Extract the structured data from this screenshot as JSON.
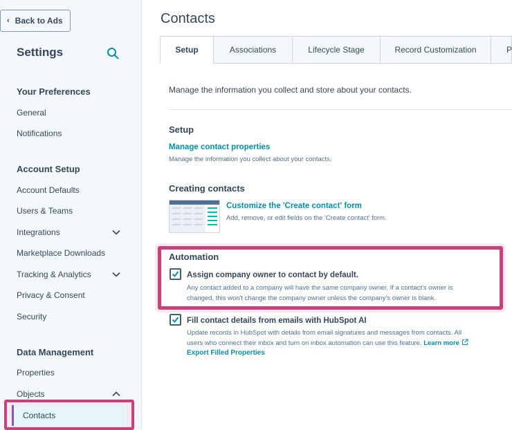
{
  "sidebar": {
    "back_label": "Back to Ads",
    "title": "Settings",
    "sections": [
      {
        "title": "Your Preferences",
        "items": [
          "General",
          "Notifications"
        ]
      },
      {
        "title": "Account Setup",
        "items": [
          "Account Defaults",
          "Users & Teams",
          "Integrations",
          "Marketplace Downloads",
          "Tracking & Analytics",
          "Privacy & Consent",
          "Security"
        ]
      },
      {
        "title": "Data Management",
        "items": [
          "Properties",
          "Objects"
        ]
      }
    ],
    "active_item": "Contacts"
  },
  "main": {
    "title": "Contacts",
    "tabs": [
      "Setup",
      "Associations",
      "Lifecycle Stage",
      "Record Customization",
      "P"
    ],
    "intro": "Manage the information you collect and store about your contacts.",
    "setup": {
      "heading": "Setup",
      "link": "Manage contact properties",
      "desc": "Manage the information you collect about your contacts."
    },
    "creating": {
      "heading": "Creating contacts",
      "link": "Customize the 'Create contact' form",
      "desc": "Add, remove, or edit fields on the 'Create contact' form."
    },
    "automation": {
      "heading": "Automation",
      "option1": {
        "label": "Assign company owner to contact by default.",
        "desc_line1": "Any contact added to a company will have the same company owner. If a contact's owner is",
        "desc_line2": "changed, this won't change the company owner unless the company's owner is blank."
      },
      "option2": {
        "label": "Fill contact details from emails with HubSpot AI",
        "desc_line1": "Update records in HubSpot with details from email signatures and messages from contacts. All",
        "desc_line2": "users who connect their inbox and turn on inbox automation can use this feature.",
        "learn_more": "Learn more",
        "export_link": "Export Filled Properties"
      }
    }
  },
  "colors": {
    "accent": "#0091ae",
    "highlight": "#c8417a",
    "text": "#33475b"
  }
}
